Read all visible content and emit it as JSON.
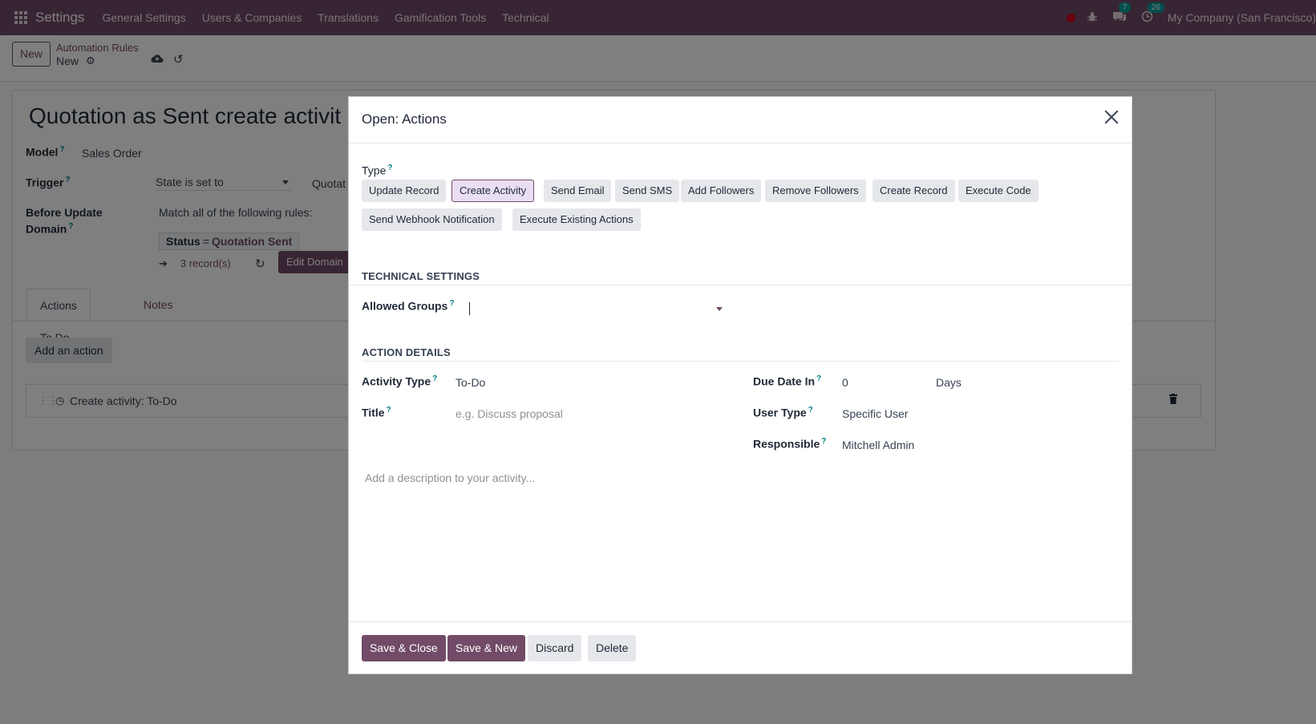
{
  "navbar": {
    "brand": "Settings",
    "menu": [
      "General Settings",
      "Users & Companies",
      "Translations",
      "Gamification Tools",
      "Technical"
    ],
    "chat_badge": "7",
    "activity_badge": "26",
    "company": "My Company (San Francisco)",
    "icons": [
      "apps-grid-icon",
      "recording-dot-icon",
      "bug-icon",
      "chat-icon",
      "clock-icon"
    ]
  },
  "control_panel": {
    "new_label": "New",
    "breadcrumb_parent": "Automation Rules",
    "breadcrumb_current": "New"
  },
  "form": {
    "title": "Quotation as Sent create activit",
    "model_label": "Model",
    "model_value": "Sales Order",
    "trigger_label": "Trigger",
    "trigger_value": "State is set to",
    "trigger_value2": "Quotat",
    "before_update_label_1": "Before Update",
    "before_update_label_2": "Domain",
    "match_text": "Match all of the following rules:",
    "status_field": "Status",
    "status_op": "=",
    "status_value": "Quotation Sent",
    "records": "3 record(s)",
    "edit_domain": "Edit Domain",
    "tabs": [
      "Actions To Do",
      "Notes"
    ],
    "add_action": "Add an action",
    "action_row": "Create activity: To-Do"
  },
  "modal": {
    "title": "Open: Actions",
    "type_label": "Type",
    "type_options": [
      "Update Record",
      "Create Activity",
      "Send Email",
      "Send SMS",
      "Add Followers",
      "Remove Followers",
      "Create Record",
      "Execute Code",
      "Send Webhook Notification",
      "Execute Existing Actions"
    ],
    "type_selected": "Create Activity",
    "technical_settings": "TECHNICAL SETTINGS",
    "allowed_groups_label": "Allowed Groups",
    "allowed_groups_value": "",
    "action_details": "ACTION DETAILS",
    "activity_type_label": "Activity Type",
    "activity_type_value": "To-Do",
    "title_label": "Title",
    "title_placeholder": "e.g. Discuss proposal",
    "due_date_label": "Due Date In",
    "due_date_value": "0",
    "due_date_unit": "Days",
    "user_type_label": "User Type",
    "user_type_value": "Specific User",
    "responsible_label": "Responsible",
    "responsible_value": "Mitchell Admin",
    "description_placeholder": "Add a description to your activity...",
    "footer": {
      "save_close": "Save & Close",
      "save_new": "Save & New",
      "discard": "Discard",
      "delete": "Delete"
    }
  },
  "colors": {
    "brand_purple": "#714b67",
    "help_teal": "#017e84",
    "badge_teal": "#00a09d",
    "record_red": "#d0021b"
  }
}
